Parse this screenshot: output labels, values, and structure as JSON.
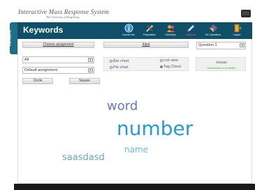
{
  "brand": {
    "logo": "Interactive Mass Response System",
    "logo_sub": "The University of Hong Kong"
  },
  "side_tab": {
    "label": "iClass"
  },
  "header": {
    "title": "Keywords"
  },
  "nav": [
    {
      "label": "Course Info",
      "icon": "info-icon"
    },
    {
      "label": "Preparation",
      "icon": "tools-icon"
    },
    {
      "label": "Onlookup",
      "icon": "people-icon"
    },
    {
      "label": "Keyword",
      "icon": "pencil-icon",
      "active": true
    },
    {
      "label": "MC Questions",
      "icon": "mc-icon"
    },
    {
      "label": "Logout",
      "icon": "door-icon"
    }
  ],
  "controls": {
    "choose_assignment": "Choose assignment",
    "filter_all": "All",
    "assignment": "Default assignment",
    "circle": "Circle",
    "square": "Square",
    "input_label": "Input",
    "question": "Question 1",
    "bar_chart": "Bar chart",
    "pie_chart": "Pie chart",
    "list_view": "List view",
    "tag_cloud": "Tag Cloud",
    "choose": "Choose",
    "status_msg": "Submission is Enabled"
  },
  "tag_cloud": [
    {
      "text": "word",
      "color": "#6677cc"
    },
    {
      "text": "number",
      "color": "#1e9fd8"
    },
    {
      "text": "name",
      "color": "#66bbee"
    },
    {
      "text": "saasdasd",
      "color": "#6fa0c8"
    }
  ],
  "colors": {
    "header": "#0f4f67",
    "side_tab": "#1f6d86",
    "status": "#22cc22"
  }
}
